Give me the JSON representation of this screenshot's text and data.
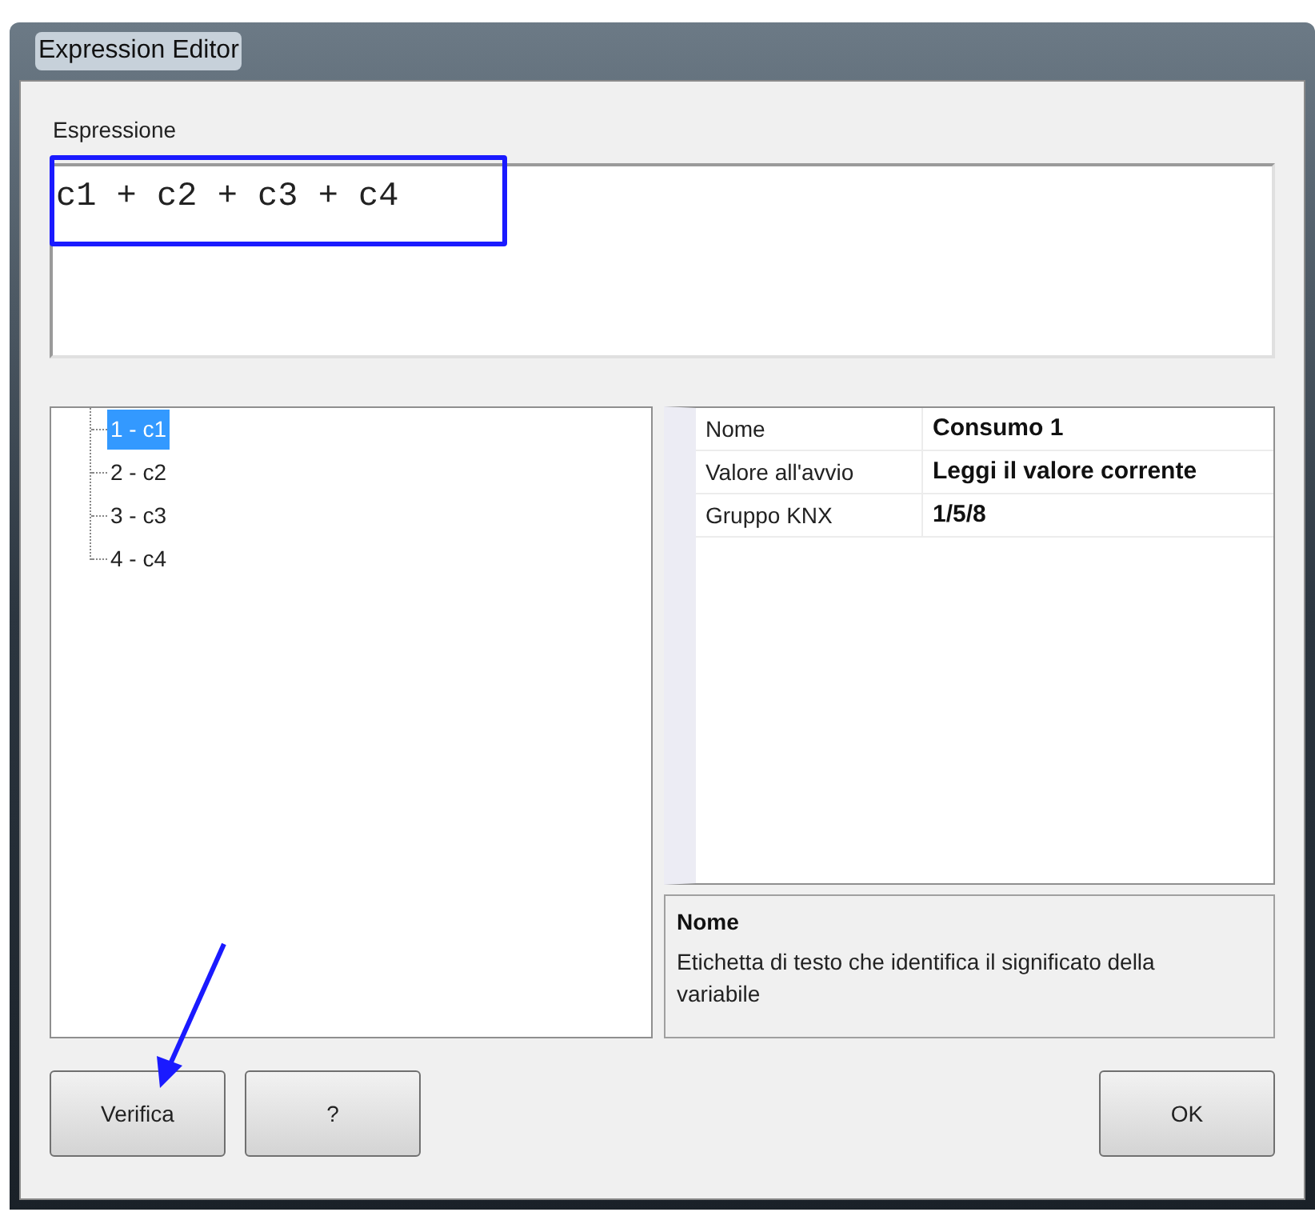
{
  "window": {
    "title": "Expression Editor"
  },
  "expression": {
    "label": "Espressione",
    "value": "c1 + c2 + c3 + c4"
  },
  "tree": {
    "items": [
      {
        "label": "1 - c1",
        "selected": true
      },
      {
        "label": "2 - c2",
        "selected": false
      },
      {
        "label": "3 - c3",
        "selected": false
      },
      {
        "label": "4 - c4",
        "selected": false
      }
    ]
  },
  "properties": {
    "rows": [
      {
        "name": "Nome",
        "value": "Consumo 1"
      },
      {
        "name": "Valore all'avvio",
        "value": "Leggi il valore corrente"
      },
      {
        "name": "Gruppo KNX",
        "value": "1/5/8"
      }
    ]
  },
  "description": {
    "title": "Nome",
    "text": "Etichetta di testo che identifica il significato della variabile"
  },
  "buttons": {
    "left": [
      "Verifica",
      "?"
    ],
    "right": [
      "OK"
    ]
  }
}
